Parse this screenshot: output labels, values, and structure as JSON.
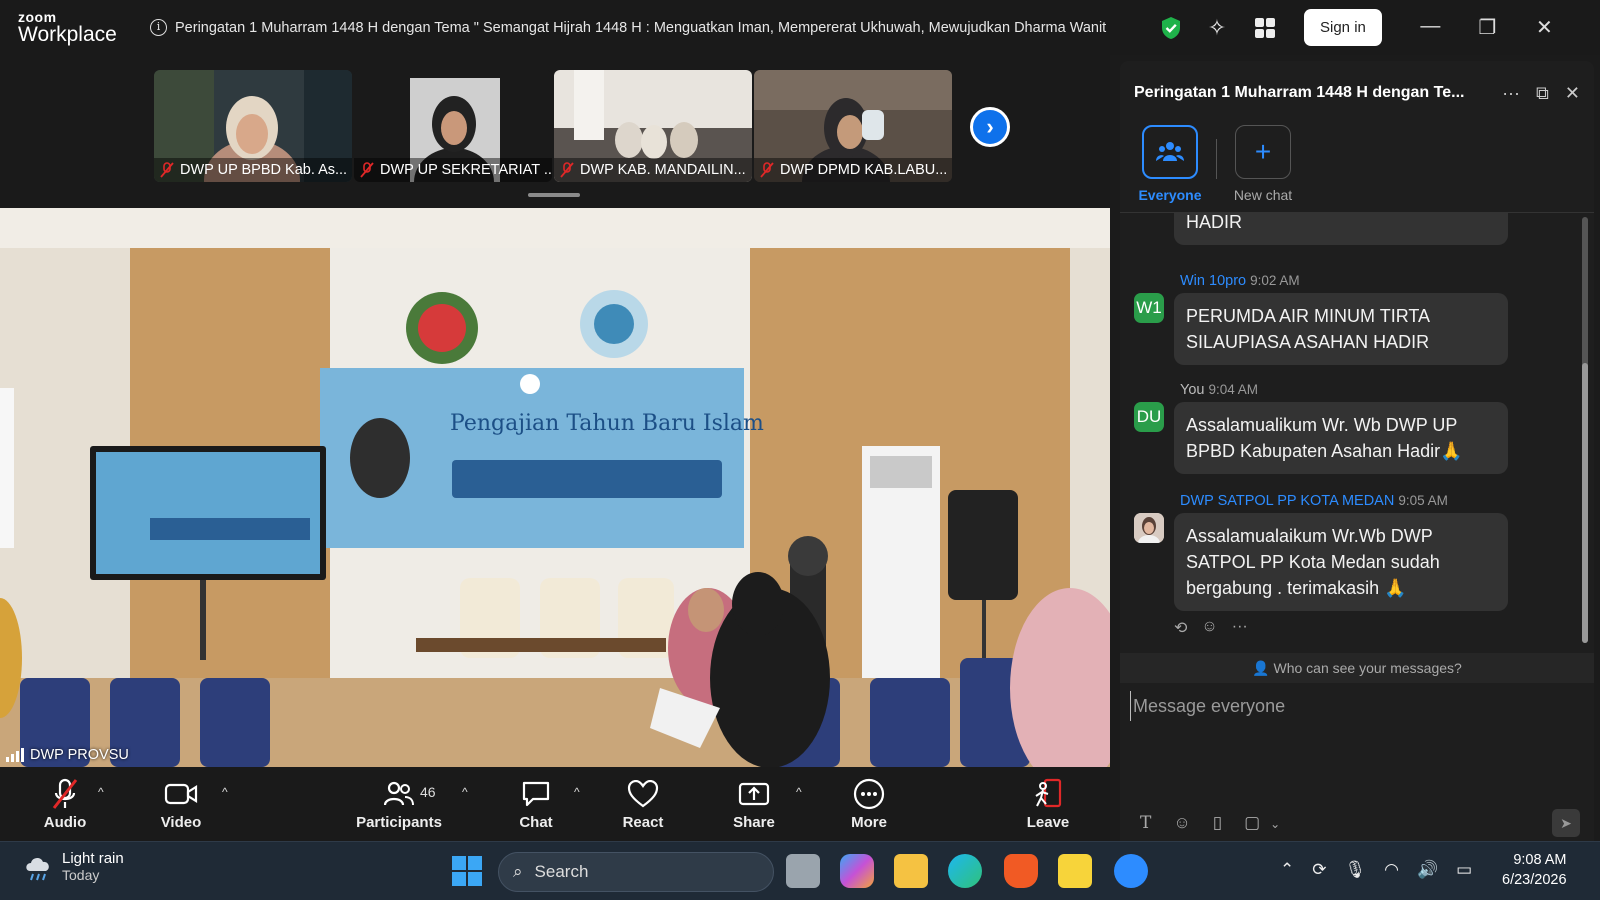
{
  "app": {
    "logo_line1": "zoom",
    "logo_line2": "Workplace"
  },
  "titlebar": {
    "meeting_title": "Peringatan 1 Muharram 1448 H dengan Tema \" Semangat Hijrah 1448 H : Menguatkan Iman, Mempererat Ukhuwah, Mewujudkan Dharma Wanit",
    "signin_label": "Sign in"
  },
  "thumbnails": [
    {
      "name": "DWP UP BPBD Kab. As..."
    },
    {
      "name": "DWP UP SEKRETARIAT ..."
    },
    {
      "name": "DWP KAB. MANDAILIN..."
    },
    {
      "name": "DWP DPMD KAB.LABU..."
    }
  ],
  "main_video": {
    "speaker": "DWP PROVSU"
  },
  "toolbar": {
    "audio": "Audio",
    "video": "Video",
    "participants": "Participants",
    "participants_count": "46",
    "chat": "Chat",
    "react": "React",
    "share": "Share",
    "more": "More",
    "leave": "Leave"
  },
  "chat": {
    "title": "Peringatan 1 Muharram 1448 H dengan Te...",
    "tabs": {
      "everyone": "Everyone",
      "new_chat": "New chat"
    },
    "partial_message": "HADIR",
    "messages": [
      {
        "avatar": "W1",
        "sender": "Win 10pro",
        "time": "9:02 AM",
        "text": "PERUMDA AIR MINUM TIRTA SILAUPIASA ASAHAN HADIR"
      },
      {
        "avatar": "DU",
        "sender": "You",
        "time": "9:04 AM",
        "text": "Assalamualikum Wr. Wb DWP UP BPBD Kabupaten Asahan Hadir🙏"
      },
      {
        "avatar": "",
        "sender": "DWP SATPOL PP KOTA MEDAN",
        "time": "9:05 AM",
        "text": "Assalamualaikum Wr.Wb DWP SATPOL PP Kota Medan sudah bergabung . terimakasih 🙏"
      }
    ],
    "privacy_note": "Who can see your messages?",
    "input_placeholder": "Message everyone"
  },
  "taskbar": {
    "weather_title": "Light rain",
    "weather_sub": "Today",
    "search_label": "Search",
    "time": "9:08 AM",
    "date": "6/23/2026"
  },
  "colors": {
    "accent": "#0e71eb",
    "chat_link": "#2d8cff",
    "avatar_green": "#2a9d4a",
    "leave_red": "#e02828"
  }
}
